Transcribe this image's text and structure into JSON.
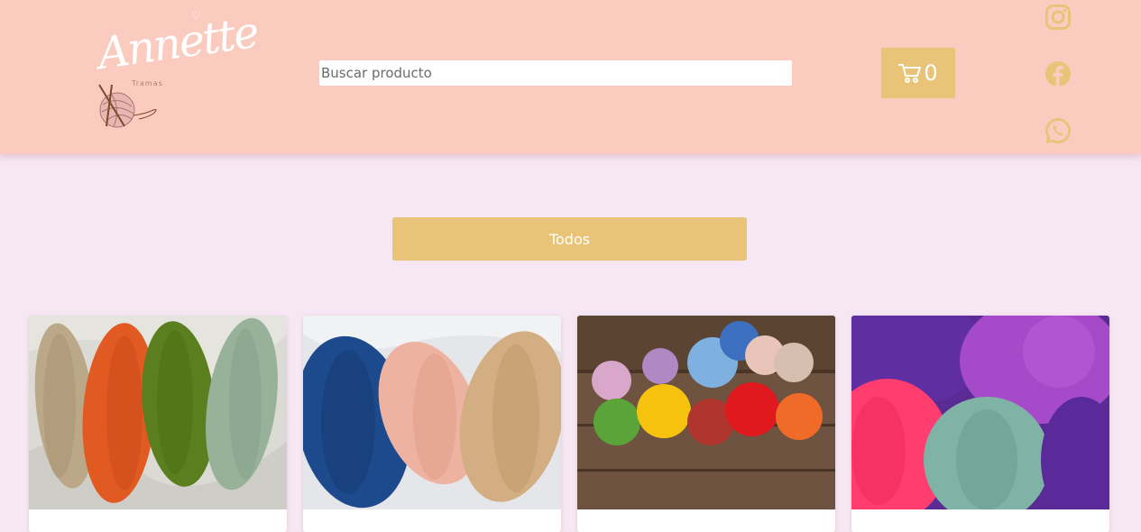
{
  "header": {
    "logo": {
      "script_text": "Annette",
      "sub_text": "Tramas"
    },
    "search": {
      "placeholder": "Buscar producto",
      "value": ""
    },
    "cart": {
      "icon": "cart-icon",
      "count": "0"
    },
    "social": [
      {
        "icon": "instagram-icon"
      },
      {
        "icon": "facebook-icon"
      },
      {
        "icon": "whatsapp-icon"
      }
    ]
  },
  "filter": {
    "label": "Todos"
  },
  "products": [
    {
      "image": "yarn-beige-orange-green-sage"
    },
    {
      "image": "yarn-blue-peach-tan"
    },
    {
      "image": "yarn-balls-on-wood"
    },
    {
      "image": "yarn-purple-pink-teal"
    }
  ],
  "colors": {
    "header_bg": "#fbcbc0",
    "page_bg": "#f7e6f3",
    "accent": "#e8c378",
    "white": "#ffffff"
  }
}
